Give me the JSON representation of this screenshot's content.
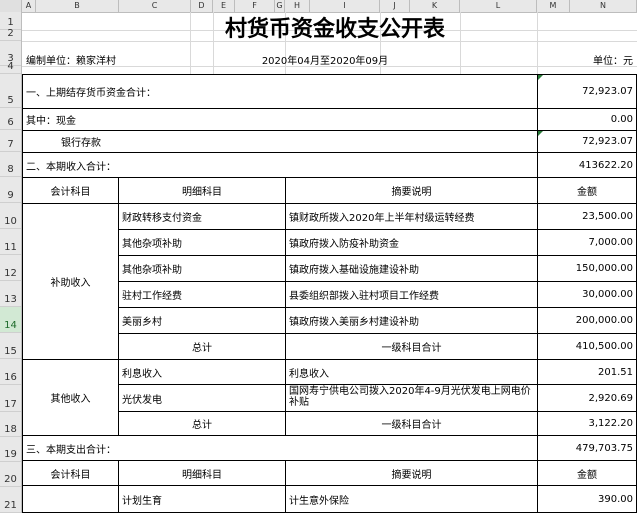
{
  "columns": [
    "A",
    "B",
    "C",
    "D",
    "E",
    "F",
    "G",
    "H",
    "I",
    "J",
    "K",
    "L",
    "M",
    "N"
  ],
  "rows": [
    "1",
    "2",
    "3",
    "4",
    "5",
    "6",
    "7",
    "8",
    "9",
    "10",
    "11",
    "12",
    "13",
    "14",
    "15",
    "16",
    "17",
    "18",
    "19",
    "20",
    "21"
  ],
  "title": "村货币资金收支公开表",
  "header": {
    "unit_left": "编制单位：赖家洋村",
    "period": "2020年04月至2020年09月",
    "unit_right": "单位：元"
  },
  "section1": {
    "label": "一、上期结存货币资金合计：",
    "amount": "72,923.07"
  },
  "cash": {
    "label": "其中：现金",
    "amount": "0.00"
  },
  "bank": {
    "label": "银行存款",
    "amount": "72,923.07"
  },
  "section2": {
    "label": "二、本期收入合计：",
    "amount": "413622.20"
  },
  "table_header": {
    "account": "会计科目",
    "detail": "明细科目",
    "desc": "摘要说明",
    "amount": "金额"
  },
  "subsidy": {
    "account": "补助收入",
    "items": [
      {
        "detail": "财政转移支付资金",
        "desc": "镇财政所拨入2020年上半年村级运转经费",
        "amount": "23,500.00"
      },
      {
        "detail": "其他杂项补助",
        "desc": "镇政府拨入防疫补助资金",
        "amount": "7,000.00"
      },
      {
        "detail": "其他杂项补助",
        "desc": "镇政府拨入基础设施建设补助",
        "amount": "150,000.00"
      },
      {
        "detail": "驻村工作经费",
        "desc": "县委组织部拨入驻村项目工作经费",
        "amount": "30,000.00"
      },
      {
        "detail": "美丽乡村",
        "desc": "镇政府拨入美丽乡村建设补助",
        "amount": "200,000.00"
      }
    ],
    "total_label": "总计",
    "level_label": "一级科目合计",
    "total_amount": "410,500.00"
  },
  "other": {
    "account": "其他收入",
    "items": [
      {
        "detail": "利息收入",
        "desc": "利息收入",
        "amount": "201.51"
      },
      {
        "detail": "光伏发电",
        "desc": "国网寿宁供电公司拨入2020年4-9月光伏发电上网电价补贴",
        "amount": "2,920.69"
      }
    ],
    "total_label": "总计",
    "level_label": "一级科目合计",
    "total_amount": "3,122.20"
  },
  "section3": {
    "label": "三、本期支出合计：",
    "amount": "479,703.75"
  },
  "expense_header": {
    "account": "会计科目",
    "detail": "明细科目",
    "desc": "摘要说明",
    "amount": "金额"
  },
  "expense_first": {
    "detail": "计划生育",
    "desc": "计生意外保险",
    "amount": "390.00"
  },
  "selected_row": "14"
}
